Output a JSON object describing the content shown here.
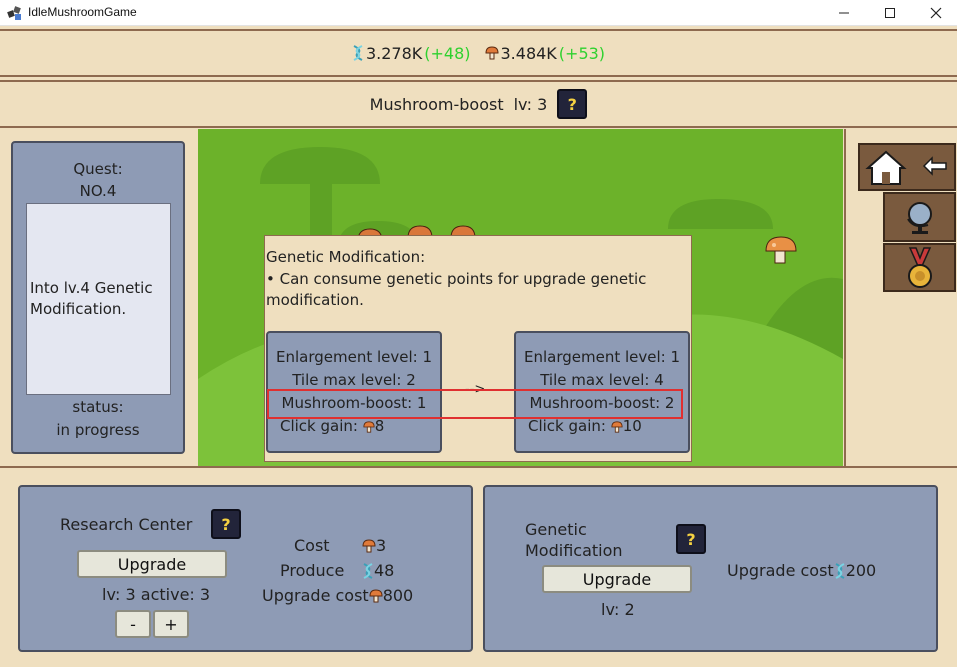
{
  "window": {
    "title": "IdleMushroomGame"
  },
  "resources": {
    "dna_value": "3.278K",
    "dna_rate": "(+48)",
    "mushroom_value": "3.484K",
    "mushroom_rate": "(+53)"
  },
  "boost_bar": {
    "label": "Mushroom-boost",
    "level_label": "lv: 3",
    "help": "?"
  },
  "quest": {
    "title": "Quest:",
    "number": "NO.4",
    "description": "Into lv.4 Genetic Modification.",
    "status_label": "status:",
    "status_value": "in progress"
  },
  "popup": {
    "title": "Genetic Modification:",
    "description": "• Can consume genetic points for upgrade genetic modification.",
    "arrow": "-->",
    "current": {
      "enlargement": "Enlargement level: 1",
      "tile_max": "Tile max level: 2",
      "boost": "Mushroom-boost: 1",
      "click_label": "Click gain:",
      "click_value": "8"
    },
    "next": {
      "enlargement": "Enlargement level: 1",
      "tile_max": "Tile max level: 4",
      "boost": "Mushroom-boost: 2",
      "click_label": "Click gain:",
      "click_value": "10"
    }
  },
  "research": {
    "title": "Research Center",
    "help": "?",
    "upgrade_label": "Upgrade",
    "level_text": "lv: 3 active: 3",
    "minus": "-",
    "plus": "+",
    "cost_label": "Cost",
    "cost_value": "3",
    "produce_label": "Produce",
    "produce_value": "48",
    "upgrade_cost_label": "Upgrade cost",
    "upgrade_cost_value": "800"
  },
  "genetic": {
    "title_line1": "Genetic",
    "title_line2": "Modification",
    "help": "?",
    "upgrade_label": "Upgrade",
    "level_text": "lv: 2",
    "upgrade_cost_label": "Upgrade cost",
    "upgrade_cost_value": "200"
  },
  "colors": {
    "gain_green": "#2fd12f",
    "highlight_red": "#e03030",
    "panel_blue": "#8e9bb5",
    "background": "#efdfbf"
  }
}
